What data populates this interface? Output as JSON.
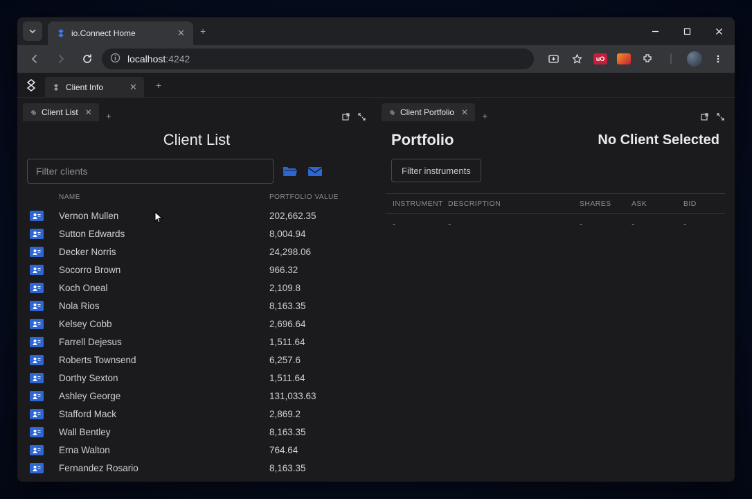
{
  "browser": {
    "tab_title": "io.Connect Home",
    "url_host": "localhost",
    "url_port": ":4242"
  },
  "workspace": {
    "tab_label": "Client Info"
  },
  "left_panel": {
    "tab_label": "Client List",
    "title": "Client List",
    "filter_placeholder": "Filter clients",
    "headers": {
      "name": "NAME",
      "value": "PORTFOLIO VALUE"
    },
    "clients": [
      {
        "name": "Vernon Mullen",
        "value": "202,662.35"
      },
      {
        "name": "Sutton Edwards",
        "value": "8,004.94"
      },
      {
        "name": "Decker Norris",
        "value": "24,298.06"
      },
      {
        "name": "Socorro Brown",
        "value": "966.32"
      },
      {
        "name": "Koch Oneal",
        "value": "2,109.8"
      },
      {
        "name": "Nola Rios",
        "value": "8,163.35"
      },
      {
        "name": "Kelsey Cobb",
        "value": "2,696.64"
      },
      {
        "name": "Farrell Dejesus",
        "value": "1,511.64"
      },
      {
        "name": "Roberts Townsend",
        "value": "6,257.6"
      },
      {
        "name": "Dorthy Sexton",
        "value": "1,511.64"
      },
      {
        "name": "Ashley George",
        "value": "131,033.63"
      },
      {
        "name": "Stafford Mack",
        "value": "2,869.2"
      },
      {
        "name": "Wall Bentley",
        "value": "8,163.35"
      },
      {
        "name": "Erna Walton",
        "value": "764.64"
      },
      {
        "name": "Fernandez Rosario",
        "value": "8,163.35"
      }
    ]
  },
  "right_panel": {
    "tab_label": "Client Portfolio",
    "title": "Portfolio",
    "no_client_label": "No Client Selected",
    "filter_button": "Filter instruments",
    "headers": {
      "instrument": "INSTRUMENT",
      "description": "DESCRIPTION",
      "shares": "SHARES",
      "ask": "ASK",
      "bid": "BID"
    },
    "empty": "-"
  }
}
